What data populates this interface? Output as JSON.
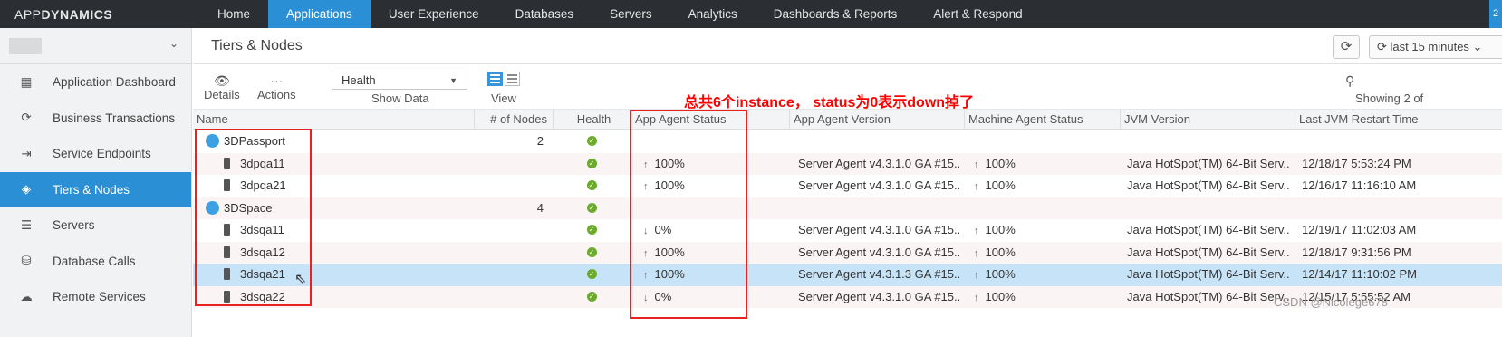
{
  "logo": {
    "pre": "APP",
    "bold": "DYNAMICS"
  },
  "nav": [
    "Home",
    "Applications",
    "User Experience",
    "Databases",
    "Servers",
    "Analytics",
    "Dashboards & Reports",
    "Alert & Respond"
  ],
  "nav_active": "Applications",
  "nav_corner": "2",
  "sidebar": {
    "items": [
      {
        "label": "Application Dashboard",
        "icon": "dashboard-icon",
        "glyph": "▦"
      },
      {
        "label": "Business Transactions",
        "icon": "transactions-icon",
        "glyph": "⟳"
      },
      {
        "label": "Service Endpoints",
        "icon": "endpoints-icon",
        "glyph": "⇥"
      },
      {
        "label": "Tiers & Nodes",
        "icon": "tiers-icon",
        "glyph": "◈"
      },
      {
        "label": "Servers",
        "icon": "servers-icon",
        "glyph": "☰"
      },
      {
        "label": "Database Calls",
        "icon": "database-icon",
        "glyph": "⛁"
      },
      {
        "label": "Remote Services",
        "icon": "cloud-icon",
        "glyph": "☁"
      }
    ],
    "active": "Tiers & Nodes"
  },
  "main": {
    "title": "Tiers & Nodes",
    "time_range": "⟳ last 15 minutes ⌄",
    "toolbar": {
      "details": "Details",
      "actions": "Actions",
      "health_select": "Health",
      "show_data": "Show Data",
      "view": "View",
      "showing": "Showing 2 of"
    },
    "annotation": "总共6个instance， status为0表示down掉了"
  },
  "table": {
    "columns": [
      "Name",
      "# of Nodes",
      "Health",
      "App Agent Status",
      "App Agent Version",
      "Machine Agent Status",
      "JVM Version",
      "Last JVM Restart Time"
    ],
    "rows": [
      {
        "kind": "tier",
        "name": "3DPassport",
        "nodes": "2",
        "health": "ok",
        "app_status": "",
        "app_dir": "",
        "agent_version": "",
        "machine_status": "",
        "machine_dir": "",
        "jvm": "",
        "restart": ""
      },
      {
        "kind": "node",
        "name": "3dpqa11",
        "nodes": "",
        "health": "ok",
        "app_status": "100%",
        "app_dir": "↑",
        "agent_version": "Server Agent v4.3.1.0 GA #15...",
        "machine_status": "100%",
        "machine_dir": "↑",
        "jvm": "Java HotSpot(TM) 64-Bit Serv...",
        "restart": "12/18/17 5:53:24 PM"
      },
      {
        "kind": "node",
        "name": "3dpqa21",
        "nodes": "",
        "health": "ok",
        "app_status": "100%",
        "app_dir": "↑",
        "agent_version": "Server Agent v4.3.1.0 GA #15...",
        "machine_status": "100%",
        "machine_dir": "↑",
        "jvm": "Java HotSpot(TM) 64-Bit Serv...",
        "restart": "12/16/17 11:16:10 AM"
      },
      {
        "kind": "tier",
        "name": "3DSpace",
        "nodes": "4",
        "health": "ok",
        "app_status": "",
        "app_dir": "",
        "agent_version": "",
        "machine_status": "",
        "machine_dir": "",
        "jvm": "",
        "restart": ""
      },
      {
        "kind": "node",
        "name": "3dsqa11",
        "nodes": "",
        "health": "ok",
        "app_status": "0%",
        "app_dir": "↓",
        "agent_version": "Server Agent v4.3.1.0 GA #15...",
        "machine_status": "100%",
        "machine_dir": "↑",
        "jvm": "Java HotSpot(TM) 64-Bit Serv...",
        "restart": "12/19/17 11:02:03 AM"
      },
      {
        "kind": "node",
        "name": "3dsqa12",
        "nodes": "",
        "health": "ok",
        "app_status": "100%",
        "app_dir": "↑",
        "agent_version": "Server Agent v4.3.1.0 GA #15...",
        "machine_status": "100%",
        "machine_dir": "↑",
        "jvm": "Java HotSpot(TM) 64-Bit Serv...",
        "restart": "12/18/17 9:31:56 PM"
      },
      {
        "kind": "node",
        "name": "3dsqa21",
        "nodes": "",
        "health": "ok",
        "app_status": "100%",
        "app_dir": "↑",
        "agent_version": "Server Agent v4.3.1.3 GA #15...",
        "machine_status": "100%",
        "machine_dir": "↑",
        "jvm": "Java HotSpot(TM) 64-Bit Serv...",
        "restart": "12/14/17 11:10:02 PM",
        "selected": true
      },
      {
        "kind": "node",
        "name": "3dsqa22",
        "nodes": "",
        "health": "ok",
        "app_status": "0%",
        "app_dir": "↓",
        "agent_version": "Server Agent v4.3.1.0 GA #15...",
        "machine_status": "100%",
        "machine_dir": "↑",
        "jvm": "Java HotSpot(TM) 64-Bit Serv...",
        "restart": "12/15/17 5:55:52 AM"
      }
    ]
  },
  "watermark": "CSDN @Nicolege678",
  "colors": {
    "accent": "#2b8fd6",
    "annotation": "#ff0000",
    "health_ok": "#6aaa2c"
  }
}
